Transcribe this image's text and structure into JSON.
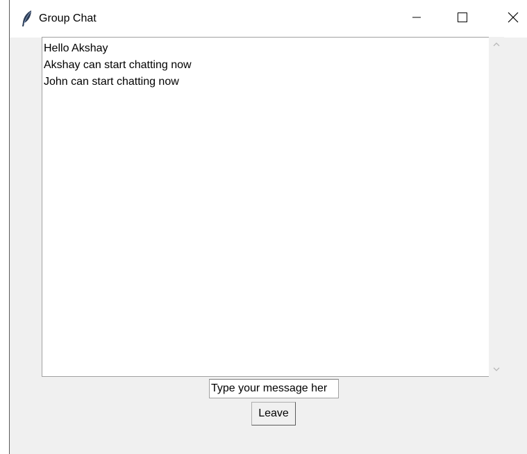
{
  "window": {
    "title": "Group Chat",
    "icon": "feather-icon"
  },
  "title_controls": {
    "minimize_icon": "minimize-icon",
    "maximize_icon": "maximize-icon",
    "close_icon": "close-icon"
  },
  "chat": {
    "messages": [
      "Hello Akshay",
      "Akshay can start chatting now",
      "John can start chatting now"
    ]
  },
  "input": {
    "value": "Type your message her"
  },
  "buttons": {
    "leave_label": "Leave"
  },
  "colors": {
    "window_bg": "#f0f0f0",
    "titlebar_bg": "#ffffff",
    "text": "#000000",
    "border": "#a0a0a0"
  }
}
